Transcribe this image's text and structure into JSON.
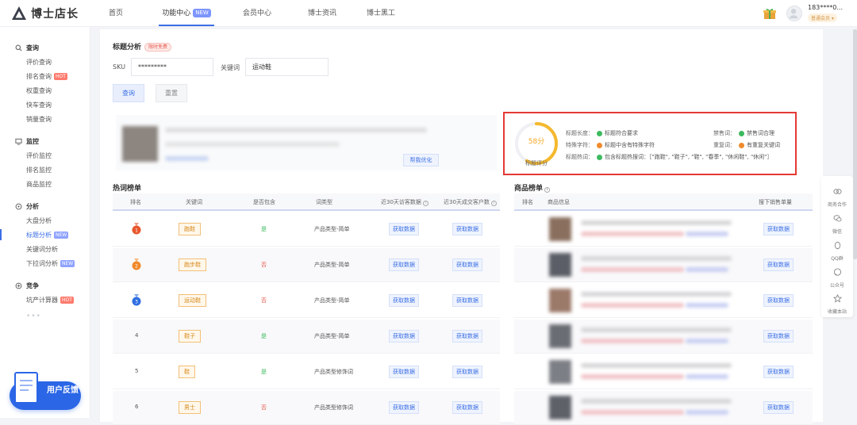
{
  "header": {
    "logo_text": "博士店长",
    "nav": [
      {
        "label": "首页",
        "active": false
      },
      {
        "label": "功能中心",
        "badge": "NEW",
        "active": true
      },
      {
        "label": "会员中心",
        "active": false
      },
      {
        "label": "博士资讯",
        "active": false
      },
      {
        "label": "博士黑工",
        "active": false
      }
    ],
    "user_name": "183****0...",
    "user_level": "普通会员 ▾"
  },
  "sidebar": {
    "groups": [
      {
        "title": "查询",
        "icon": "search-icon",
        "items": [
          {
            "label": "评价查询"
          },
          {
            "label": "排名查询",
            "tag": "HOT"
          },
          {
            "label": "权重查询"
          },
          {
            "label": "快车查询"
          },
          {
            "label": "销量查询"
          }
        ]
      },
      {
        "title": "监控",
        "icon": "monitor-icon",
        "items": [
          {
            "label": "评价监控"
          },
          {
            "label": "排名监控"
          },
          {
            "label": "商品监控"
          }
        ]
      },
      {
        "title": "分析",
        "icon": "analysis-icon",
        "items": [
          {
            "label": "大盘分析"
          },
          {
            "label": "标题分析",
            "tag": "NEW",
            "active": true
          },
          {
            "label": "关键词分析"
          },
          {
            "label": "下拉词分析",
            "tag": "NEW"
          }
        ]
      },
      {
        "title": "竞争",
        "icon": "compete-icon",
        "items": [
          {
            "label": "坑产计算器",
            "tag": "HOT"
          }
        ]
      }
    ],
    "more": "•••",
    "feedback": "用户反馈"
  },
  "search": {
    "title": "标题分析",
    "title_tag": "限时免费",
    "sku_label": "SKU",
    "sku_value": "*********",
    "keyword_label": "关键词",
    "keyword_value": "运动鞋",
    "query_button": "查询",
    "reset_button": "重置"
  },
  "product": {
    "reanalyze_button": "帮我优化"
  },
  "score": {
    "value": "58分",
    "percent": 58,
    "label": "标题评分",
    "checks": [
      {
        "key": "标题长度：",
        "status": "ok",
        "text": "标题符合要求"
      },
      {
        "key": "特殊字符：",
        "status": "warn",
        "text": "标题中含有特殊字符"
      },
      {
        "key": "标题热词：",
        "status": "ok",
        "text": "包含标题热搜词：［\"跑鞋\", \"鞋子\", \"鞋\", \"春季\", \"休闲鞋\", \"休闲\"］"
      },
      {
        "key": "禁售词：",
        "status": "ok",
        "text": "禁售词合理"
      },
      {
        "key": "重复词：",
        "status": "warn",
        "text": "有重复关键词"
      }
    ]
  },
  "hot_words": {
    "title": "热词榜单",
    "columns": [
      "排名",
      "关键词",
      "是否包含",
      "词类型",
      "近30天访客数据",
      "近30天成交客户数"
    ],
    "get_label": "获取数据",
    "rows": [
      {
        "rank": "1",
        "keyword": "跑鞋",
        "included": "是",
        "type": "产品类型-简单"
      },
      {
        "rank": "2",
        "keyword": "跑步鞋",
        "included": "否",
        "type": "产品类型-简单"
      },
      {
        "rank": "3",
        "keyword": "运动鞋",
        "included": "否",
        "type": "产品类型-简单"
      },
      {
        "rank": "4",
        "keyword": "鞋子",
        "included": "是",
        "type": "产品类型-简单"
      },
      {
        "rank": "5",
        "keyword": "鞋",
        "included": "是",
        "type": "产品类型修饰词"
      },
      {
        "rank": "6",
        "keyword": "男士",
        "included": "否",
        "type": "产品类型修饰词"
      }
    ]
  },
  "goods": {
    "title": "商品榜单",
    "columns": [
      "排名",
      "商品信息",
      "搜下销售单量"
    ],
    "get_label": "获取数据"
  },
  "float_bar": [
    {
      "label": "商务合作",
      "icon": "handshake-icon"
    },
    {
      "label": "微信",
      "icon": "wechat-icon"
    },
    {
      "label": "QQ群",
      "icon": "qq-icon"
    },
    {
      "label": "公众号",
      "icon": "chat-icon"
    },
    {
      "label": "收藏本站",
      "icon": "star-icon"
    }
  ],
  "colors": {
    "accent": "#3c6fe6",
    "warn": "#f08a2b",
    "ok": "#3dba5f",
    "highlight_border": "#e53935"
  }
}
